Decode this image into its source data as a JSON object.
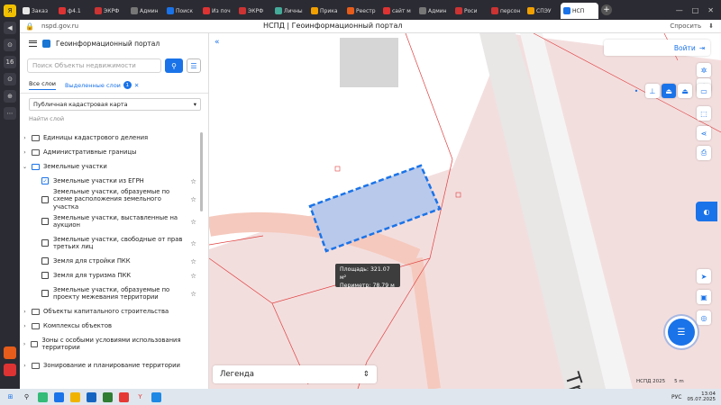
{
  "browser": {
    "tabs": [
      {
        "label": "Заказ",
        "color": "#e6e6e6"
      },
      {
        "label": "ф4.1",
        "color": "#d33"
      },
      {
        "label": "ЭКРФ",
        "color": "#c33"
      },
      {
        "label": "Админ",
        "color": "#777"
      },
      {
        "label": "Поиск",
        "color": "#1a73e8"
      },
      {
        "label": "Из поч",
        "color": "#d33"
      },
      {
        "label": "ЭКРФ",
        "color": "#c33"
      },
      {
        "label": "Личны",
        "color": "#4a9"
      },
      {
        "label": "Прика",
        "color": "#f0a000"
      },
      {
        "label": "Реестр",
        "color": "#e65c1a"
      },
      {
        "label": "сайт м",
        "color": "#d33"
      },
      {
        "label": "Админ",
        "color": "#777"
      },
      {
        "label": "Роси",
        "color": "#c33"
      },
      {
        "label": "персон",
        "color": "#c33"
      },
      {
        "label": "СПЭУ",
        "color": "#f0a000"
      },
      {
        "label": "НСП",
        "color": "#1a73e8"
      }
    ],
    "new_tab": "+",
    "url": "nspd.gov.ru",
    "page_title": "НСПД | Геоинформационный портал",
    "ask": "Спросить",
    "window_controls": [
      "—",
      "□",
      "✕"
    ]
  },
  "rail": [
    "Я",
    "◀",
    "⊙",
    "16",
    "⊙",
    "⊕",
    "⋯"
  ],
  "panel": {
    "title": "Геоинформационный портал",
    "search_placeholder": "Поиск Объекты недвижимости",
    "tab_all": "Все слои",
    "tab_selected": "Выделенные слои",
    "selected_count": "1",
    "basemap": "Публичная кадастровая карта",
    "find_layer": "Найти слой",
    "tree": [
      {
        "label": "Единицы кадастрового деления"
      },
      {
        "label": "Административные границы"
      },
      {
        "label": "Земельные участки"
      }
    ],
    "land_items": [
      {
        "label": "Земельные участки из ЕГРН",
        "checked": true
      },
      {
        "label": "Земельные участки, образуемые по схеме расположения земельного участка",
        "checked": false
      },
      {
        "label": "Земельные участки, выставленные на аукцион",
        "checked": false
      },
      {
        "label": "Земельные участки, свободные от прав третьих лиц",
        "checked": false
      },
      {
        "label": "Земля для стройки ПКК",
        "checked": false
      },
      {
        "label": "Земля для туризма ПКК",
        "checked": false
      },
      {
        "label": "Земельные участки, образуемые по проекту межевания территории",
        "checked": false
      }
    ],
    "tree_after": [
      {
        "label": "Объекты капитального строительства"
      },
      {
        "label": "Комплексы объектов"
      },
      {
        "label": "Зоны с особыми условиями использования территории"
      },
      {
        "label": "Зонирование и планирование территории"
      }
    ]
  },
  "map": {
    "login": "Войти",
    "area_label": "Площадь: 321.07 м²",
    "perimeter_label": "Периметр: 78.79 м",
    "street": "Трак",
    "legend": "Легенда",
    "copyright": "НСПД 2025",
    "scale": "5 m"
  },
  "taskbar": {
    "lang": "РУС",
    "time": "13:04",
    "date": "05.07.2025"
  }
}
